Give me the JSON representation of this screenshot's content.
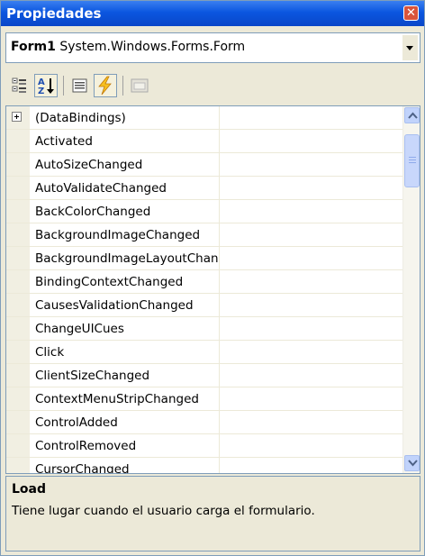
{
  "window": {
    "title": "Propiedades"
  },
  "object_selector": {
    "name": "Form1",
    "type": "System.Windows.Forms.Form"
  },
  "toolbar": {
    "buttons": [
      {
        "icon": "categorized-icon"
      },
      {
        "icon": "alphabetical-icon"
      },
      {
        "icon": "properties-icon"
      },
      {
        "icon": "events-icon"
      },
      {
        "icon": "property-pages-icon"
      }
    ]
  },
  "grid": {
    "rows": [
      {
        "name": "(DataBindings)",
        "expandable": true
      },
      {
        "name": "Activated"
      },
      {
        "name": "AutoSizeChanged"
      },
      {
        "name": "AutoValidateChanged"
      },
      {
        "name": "BackColorChanged"
      },
      {
        "name": "BackgroundImageChanged"
      },
      {
        "name": "BackgroundImageLayoutChanged"
      },
      {
        "name": "BindingContextChanged"
      },
      {
        "name": "CausesValidationChanged"
      },
      {
        "name": "ChangeUICues"
      },
      {
        "name": "Click"
      },
      {
        "name": "ClientSizeChanged"
      },
      {
        "name": "ContextMenuStripChanged"
      },
      {
        "name": "ControlAdded"
      },
      {
        "name": "ControlRemoved"
      },
      {
        "name": "CursorChanged"
      }
    ]
  },
  "description": {
    "title": "Load",
    "text": "Tiene lugar cuando el usuario carga el formulario."
  }
}
